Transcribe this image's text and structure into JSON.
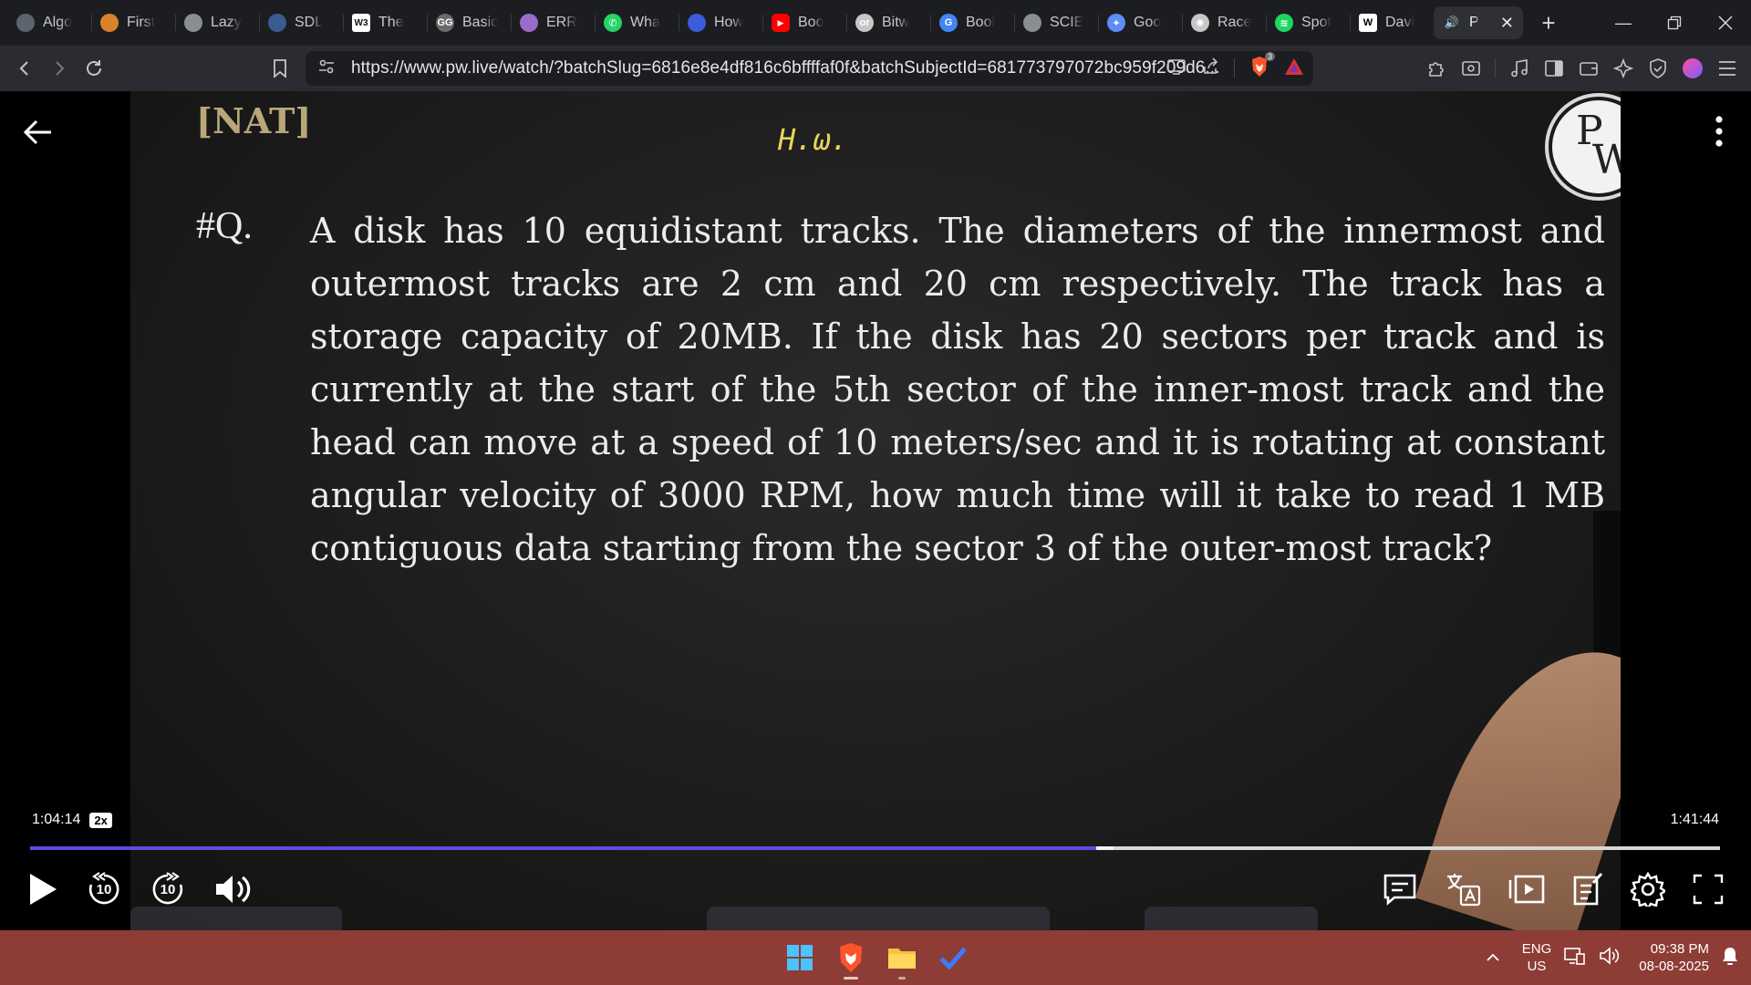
{
  "browser": {
    "tabs": [
      {
        "title": "Algo",
        "icon": "circle-chat-icon",
        "color": "#5b6470"
      },
      {
        "title": "First",
        "icon": "stack-icon",
        "color": "#d9822b"
      },
      {
        "title": "Lazy",
        "icon": "globe-icon",
        "color": "#8a8d92"
      },
      {
        "title": "SDL",
        "icon": "sdl-icon",
        "color": "#3b5b8f"
      },
      {
        "title": "The",
        "icon": "w3-icon",
        "color": "#3a6ea5"
      },
      {
        "title": "Basic",
        "icon": "gfg-icon",
        "color": "#6a6a6a"
      },
      {
        "title": "ERR",
        "icon": "brain-icon",
        "color": "#9b6bc7"
      },
      {
        "title": "Wha",
        "icon": "whatsapp-icon",
        "color": "#25d366"
      },
      {
        "title": "How",
        "icon": "bookmark-blue-icon",
        "color": "#3b5bdb"
      },
      {
        "title": "Boo",
        "icon": "youtube-icon",
        "color": "#ff0000"
      },
      {
        "title": "Bitw",
        "icon": "leetcode-icon",
        "color": "#c7c7c7"
      },
      {
        "title": "Bool",
        "icon": "google-icon",
        "color": "#4285f4"
      },
      {
        "title": "SCIE",
        "icon": "globe-icon",
        "color": "#8a8d92"
      },
      {
        "title": "Goo",
        "icon": "gemini-icon",
        "color": "#5d8df5"
      },
      {
        "title": "Race",
        "icon": "chatgpt-icon",
        "color": "#c7c7c7"
      },
      {
        "title": "Spot",
        "icon": "spotify-icon",
        "color": "#1ed760"
      },
      {
        "title": "Davi",
        "icon": "wikipedia-icon",
        "color": "#ffffff"
      },
      {
        "title": "P",
        "icon": "speaker-icon",
        "color": "#ffffff",
        "active": true
      }
    ],
    "url": "https://www.pw.live/watch/?batchSlug=6816e8e4df816c6bffffaf0f&batchSubjectId=681773797072bc959f209d6...",
    "brave_badge": "3"
  },
  "video": {
    "slide": {
      "tag": "[NAT]",
      "handwritten_note": "H.ω.",
      "question_number": "#Q.",
      "question_text": "A disk has 10 equidistant tracks. The diameters of the innermost and outermost tracks are 2 cm and 20 cm respectively. The track has a storage capacity of 20MB. If the disk has 20 sectors per track and is currently at the start of the 5th sector of the inner-most track and the head can move at a speed of 10 meters/sec and it is rotating at constant angular velocity of 3000 RPM, how much time will it take to read 1 MB contiguous data starting from the sector 3 of the outer-most track?",
      "logo_letters": [
        "P",
        "W"
      ]
    },
    "current_time": "1:04:14",
    "speed": "2x",
    "duration": "1:41:44",
    "progress_fraction": 0.631,
    "buffered_fraction": 0.641,
    "accent_color": "#5b4ee0",
    "rewind_seconds": "10",
    "forward_seconds": "10"
  },
  "taskbar": {
    "language": "ENG",
    "region": "US",
    "time": "09:38 PM",
    "date": "08-08-2025"
  }
}
